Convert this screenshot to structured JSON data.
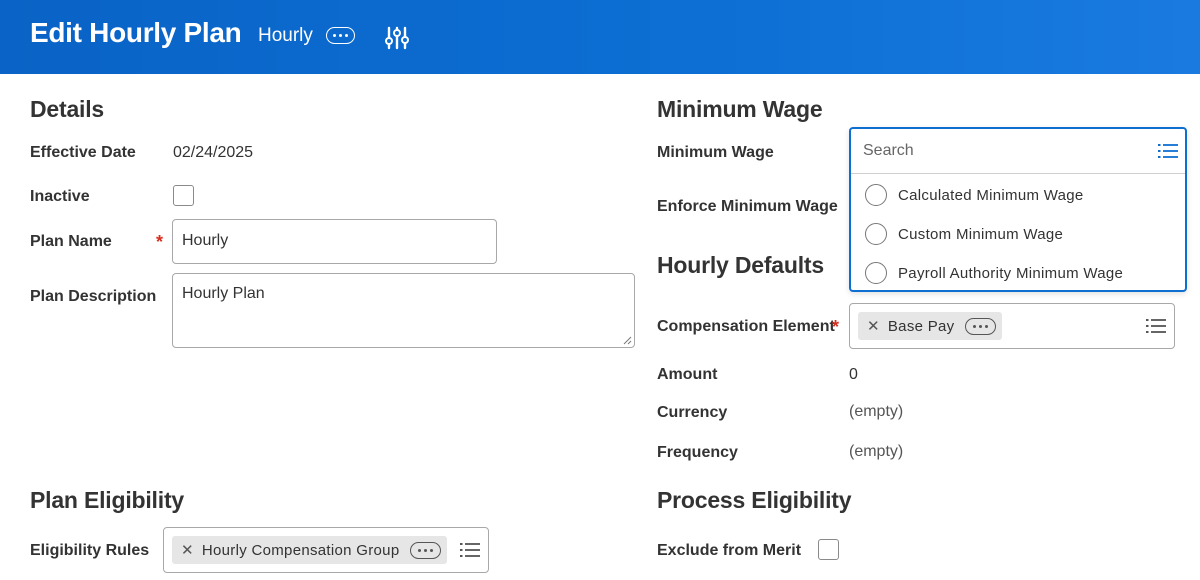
{
  "header": {
    "title": "Edit Hourly Plan",
    "subtitle": "Hourly",
    "colors": {
      "background": "#0a63c6",
      "text": "#ffffff"
    },
    "icons": {
      "more": "more-horizontal-icon",
      "settings": "sliders-icon"
    }
  },
  "details": {
    "title": "Details",
    "effective_date": {
      "label": "Effective Date",
      "value": "02/24/2025"
    },
    "inactive": {
      "label": "Inactive",
      "checked": false
    },
    "plan_name": {
      "label": "Plan Name",
      "required": "*",
      "value": "Hourly"
    },
    "plan_description": {
      "label": "Plan Description",
      "value": "Hourly Plan"
    }
  },
  "minimum_wage": {
    "title": "Minimum Wage",
    "minimum_wage_label": "Minimum Wage",
    "enforce_label": "Enforce Minimum Wage",
    "dropdown": {
      "search_placeholder": "Search",
      "options": [
        {
          "label": "Calculated Minimum Wage",
          "selected": false
        },
        {
          "label": "Custom Minimum Wage",
          "selected": false
        },
        {
          "label": "Payroll Authority Minimum Wage",
          "selected": false
        }
      ]
    }
  },
  "hourly_defaults": {
    "title": "Hourly Defaults",
    "compensation_element": {
      "label": "Compensation Element",
      "required": "*",
      "pill": "Base Pay"
    },
    "amount": {
      "label": "Amount",
      "value": "0"
    },
    "currency": {
      "label": "Currency",
      "value": "(empty)"
    },
    "frequency": {
      "label": "Frequency",
      "value": "(empty)"
    }
  },
  "plan_eligibility": {
    "title": "Plan Eligibility",
    "eligibility_rules": {
      "label": "Eligibility Rules",
      "pill": "Hourly Compensation Group"
    }
  },
  "process_eligibility": {
    "title": "Process Eligibility",
    "exclude_from_merit": {
      "label": "Exclude from Merit",
      "checked": false
    }
  },
  "colors": {
    "accent": "#0f6fd1",
    "required": "#d62e1f",
    "pill_bg": "#e6e6e6"
  }
}
